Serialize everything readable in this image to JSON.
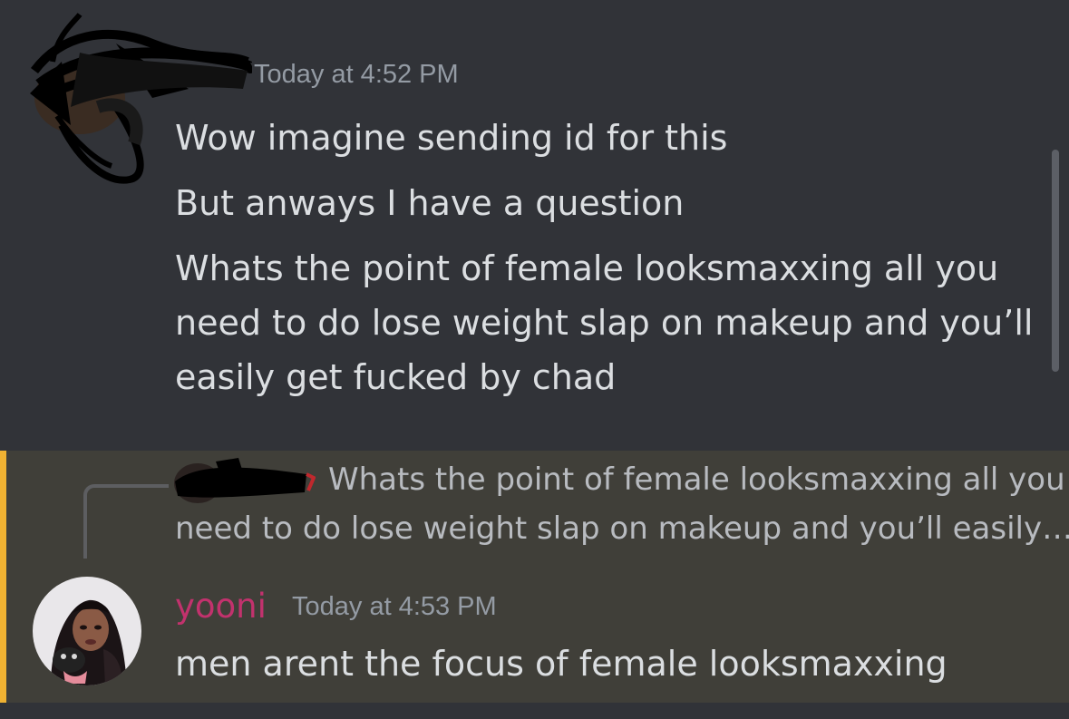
{
  "message1": {
    "timestamp": "Today at 4:52 PM",
    "lines": [
      "Wow imagine sending id for this",
      "But anways I have a question",
      "Whats the point of female looksmaxxing all you",
      "need to do lose weight slap on makeup and you’ll",
      "easily get fucked by chad"
    ]
  },
  "message2": {
    "reply_preview": {
      "line1": "Whats the point of female looksmaxxing all you",
      "line2": "need to do lose weight slap on makeup and you’ll easily…"
    },
    "username": "yooni",
    "timestamp": "Today at 4:53 PM",
    "text": "men arent the focus of female looksmaxxing"
  },
  "colors": {
    "background": "#313338",
    "mention_background": "#403f39",
    "mention_bar": "#f0b232",
    "username": "#c2326d",
    "text": "#dbdee1",
    "muted": "#949ba4"
  }
}
